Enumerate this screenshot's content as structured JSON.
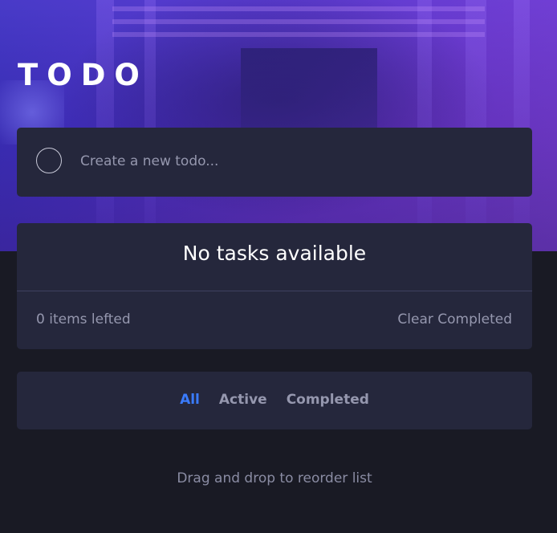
{
  "app": {
    "title": "TODO"
  },
  "create": {
    "placeholder": "Create a new todo...",
    "value": ""
  },
  "list": {
    "empty_message": "No tasks available",
    "items_left": "0 items lefted",
    "clear_label": "Clear Completed"
  },
  "filters": {
    "all": "All",
    "active": "Active",
    "completed": "Completed",
    "selected": "All"
  },
  "hint": "Drag and drop to reorder list",
  "colors": {
    "accent": "#3a7bfd",
    "card": "#25273c",
    "background": "#191a24",
    "muted_text": "#9597ae"
  }
}
